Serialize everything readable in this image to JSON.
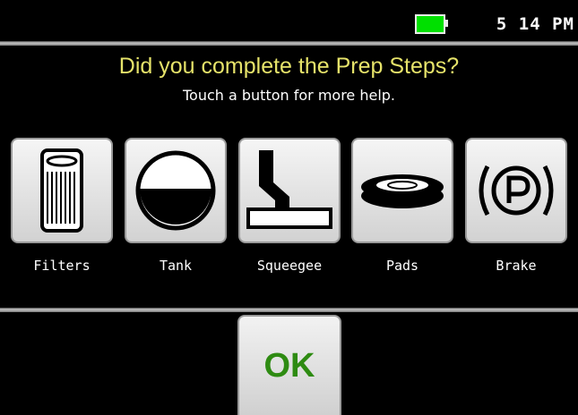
{
  "status": {
    "battery_color": "#00e000",
    "time": "5 14 PM"
  },
  "prompt": {
    "title": "Did you complete the Prep Steps?",
    "subtitle": "Touch a button for more help."
  },
  "buttons": [
    {
      "label": "Filters",
      "icon": "filter-icon"
    },
    {
      "label": "Tank",
      "icon": "tank-icon"
    },
    {
      "label": "Squeegee",
      "icon": "squeegee-icon"
    },
    {
      "label": "Pads",
      "icon": "pad-icon"
    },
    {
      "label": "Brake",
      "icon": "parking-brake-icon"
    }
  ],
  "ok_button": {
    "label": "OK",
    "color": "#2e8b12"
  }
}
